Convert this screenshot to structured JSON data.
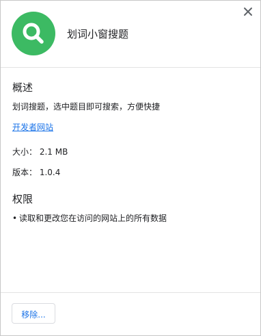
{
  "header": {
    "app_name": "划词小窗搜题",
    "icon": "search-icon",
    "icon_bg": "#3cba63"
  },
  "close": {
    "icon": "close-icon"
  },
  "overview": {
    "heading": "概述",
    "description": "划词搜题，选中题目即可搜索，方便快捷",
    "developer_link": "开发者网站",
    "size": "大小：  2.1 MB",
    "version": "版本：  1.0.4"
  },
  "permissions": {
    "heading": "权限",
    "items": [
      "读取和更改您在访问的网站上的所有数据"
    ]
  },
  "footer": {
    "remove_label": "移除..."
  },
  "colors": {
    "link": "#1a73e8",
    "text": "#202124",
    "divider": "#e3e3e3"
  }
}
